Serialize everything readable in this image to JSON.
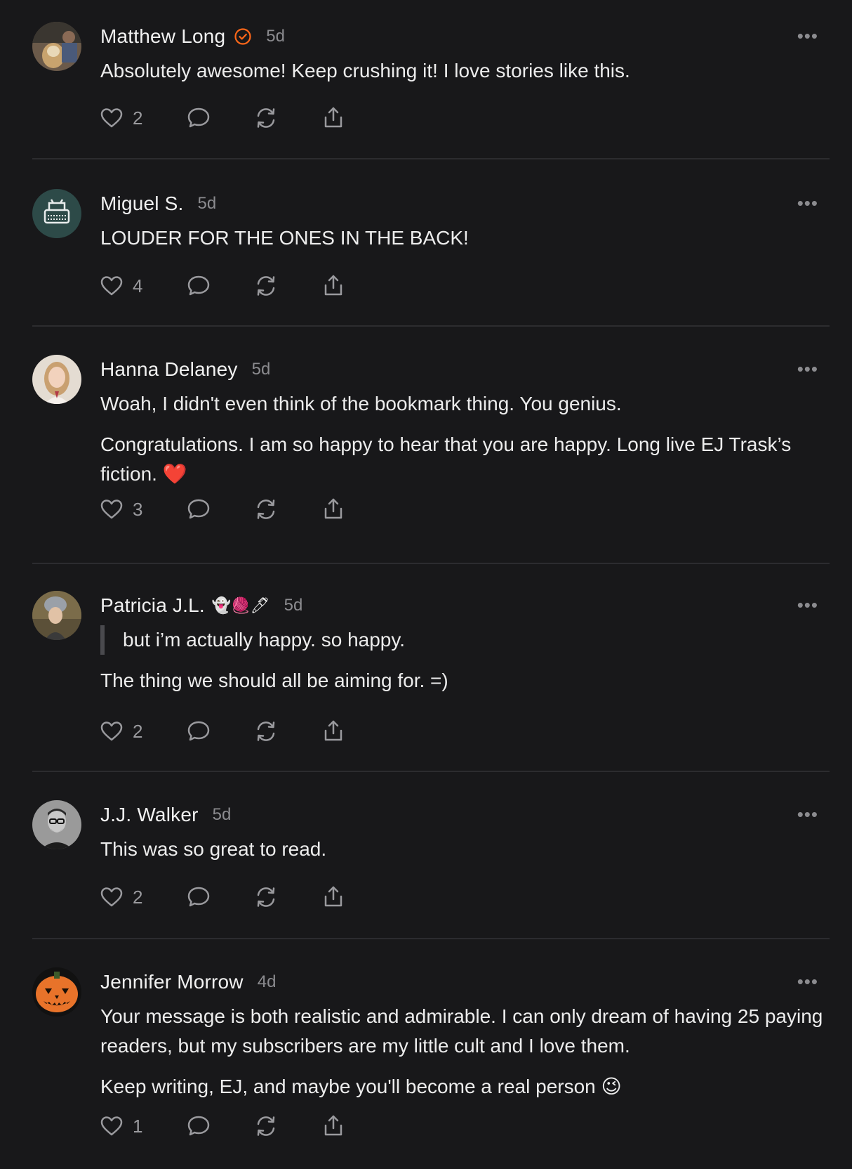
{
  "comments": [
    {
      "name": "Matthew Long",
      "verified": true,
      "time": "5d",
      "lines": [
        "Absolutely awesome! Keep crushing it! I love stories like this."
      ],
      "likes": "2"
    },
    {
      "name": "Miguel S.",
      "time": "5d",
      "lines": [
        "LOUDER FOR THE ONES IN THE BACK!"
      ],
      "likes": "4"
    },
    {
      "name": "Hanna Delaney",
      "time": "5d",
      "lines": [
        "Woah, I didn't even think of the bookmark thing. You genius.",
        "Congratulations. I am so happy to hear that you are happy. Long live EJ Trask’s fiction. ❤️"
      ],
      "likes": "3"
    },
    {
      "name": "Patricia J.L.",
      "name_emojis": "👻🧶🖊",
      "time": "5d",
      "quote": "but i’m actually happy. so happy.",
      "lines": [
        "The thing we should all be aiming for. =)"
      ],
      "likes": "2"
    },
    {
      "name": "J.J. Walker",
      "time": "5d",
      "lines": [
        "This was so great to read."
      ],
      "likes": "2"
    },
    {
      "name": "Jennifer Morrow",
      "time": "4d",
      "lines": [
        "Your message is both realistic and admirable. I can only dream of having 25 paying readers, but my subscribers are my little cult and I love them.",
        "Keep writing, EJ, and maybe you'll become a real person 😉"
      ],
      "likes": "1"
    }
  ],
  "more_label": "•••",
  "colors": {
    "background": "#18181a",
    "verified": "#ff6719",
    "divider": "#2c2c2f"
  }
}
